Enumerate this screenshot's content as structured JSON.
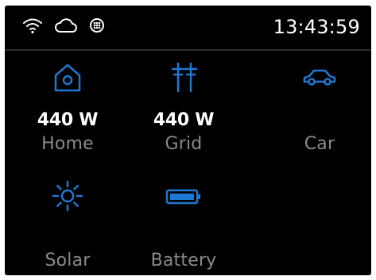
{
  "status_bar": {
    "time": "13:43:59",
    "icons": [
      "wifi-icon",
      "cloud-icon",
      "grid-dot-icon"
    ]
  },
  "tiles": [
    {
      "id": "home",
      "icon": "home-icon",
      "value": "440 W",
      "label": "Home"
    },
    {
      "id": "grid",
      "icon": "power-pylon-icon",
      "value": "440 W",
      "label": "Grid"
    },
    {
      "id": "car",
      "icon": "car-icon",
      "value": "",
      "label": "Car"
    },
    {
      "id": "solar",
      "icon": "sun-icon",
      "value": "",
      "label": "Solar"
    },
    {
      "id": "battery",
      "icon": "battery-icon",
      "value": "",
      "label": "Battery"
    }
  ],
  "colors": {
    "background": "#000000",
    "accent_blue": "#1e78d2",
    "text_primary": "#ffffff",
    "text_muted": "#8a8a8a"
  }
}
